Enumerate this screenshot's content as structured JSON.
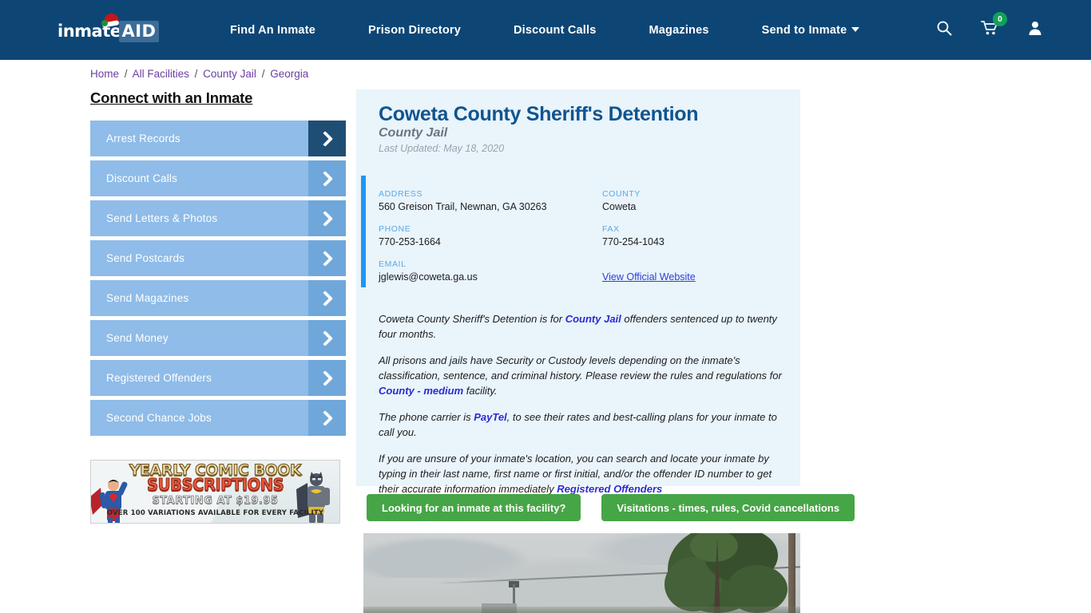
{
  "nav": {
    "logo": {
      "word1": "inmate",
      "word2": "AID",
      "icon": "santa-hat-icon"
    },
    "links": [
      {
        "label": "Find An Inmate",
        "has_caret": false
      },
      {
        "label": "Prison Directory",
        "has_caret": false
      },
      {
        "label": "Discount Calls",
        "has_caret": false
      },
      {
        "label": "Magazines",
        "has_caret": false
      },
      {
        "label": "Send to Inmate",
        "has_caret": true
      }
    ],
    "icons": {
      "search": "search-icon",
      "cart": "shopping-cart-icon",
      "cart_badge": "0",
      "account": "user-account-icon"
    },
    "background_color": "#0d4675"
  },
  "breadcrumb": {
    "items": [
      "Home",
      "All Facilities",
      "County Jail",
      "Georgia"
    ],
    "separator": "/",
    "link_color": "#6b3fa0"
  },
  "sidebar": {
    "heading": "Connect with an Inmate",
    "items": [
      {
        "label": "Arrest Records",
        "active": true
      },
      {
        "label": "Discount Calls",
        "active": false
      },
      {
        "label": "Send Letters & Photos",
        "active": false
      },
      {
        "label": "Send Postcards",
        "active": false
      },
      {
        "label": "Send Magazines",
        "active": false
      },
      {
        "label": "Send Money",
        "active": false
      },
      {
        "label": "Registered Offenders",
        "active": false
      },
      {
        "label": "Second Chance Jobs",
        "active": false
      }
    ],
    "button_color": "#8fbce8",
    "arrow_color": "#6fa7da",
    "arrow_active_color": "#1f4e74"
  },
  "ad": {
    "title_line1": "YEARLY COMIC BOOK",
    "title_line2": "SUBSCRIPTIONS",
    "subtitle": "STARTING AT $19.95",
    "footer": "OVER 100 VARIATIONS AVAILABLE FOR EVERY FACILITY"
  },
  "facility": {
    "name": "Coweta County Sheriff's Detention",
    "type": "County Jail",
    "last_updated": "Last Updated: May 18, 2020",
    "info": {
      "address_label": "ADDRESS",
      "address_value": "560 Greison Trail, Newnan, GA 30263",
      "county_label": "COUNTY",
      "county_value": "Coweta",
      "phone_label": "PHONE",
      "phone_value": "770-253-1664",
      "fax_label": "FAX",
      "fax_value": "770-254-1043",
      "email_label": "EMAIL",
      "email_value": "jglewis@coweta.ga.us",
      "website_link": "View Official Website"
    },
    "paragraphs": {
      "p1_a": "Coweta County Sheriff's Detention is for ",
      "p1_link": "County Jail",
      "p1_b": " offenders sentenced up to twenty four months.",
      "p2_a": "All prisons and jails have Security or Custody levels depending on the inmate's classification, sentence, and criminal history. Please review the rules and regulations for ",
      "p2_link": "County - medium",
      "p2_b": " facility.",
      "p3_a": "The phone carrier is ",
      "p3_link": "PayTel",
      "p3_b": ", to see their rates and best-calling plans for your inmate to call you.",
      "p4_a": "If you are unsure of your inmate's location, you can search and locate your inmate by typing in their last name, first name or first initial, and/or the offender ID number to get their accurate information immediately ",
      "p4_link": "Registered Offenders"
    },
    "card_background": "#e9f4fb",
    "accent_color": "#2196f3"
  },
  "cta": {
    "buttons": [
      "Looking for an inmate at this facility?",
      "Visitations - times, rules, Covid cancellations"
    ],
    "color": "#46a546"
  },
  "photo": {
    "alt": "facility-exterior-photo"
  }
}
